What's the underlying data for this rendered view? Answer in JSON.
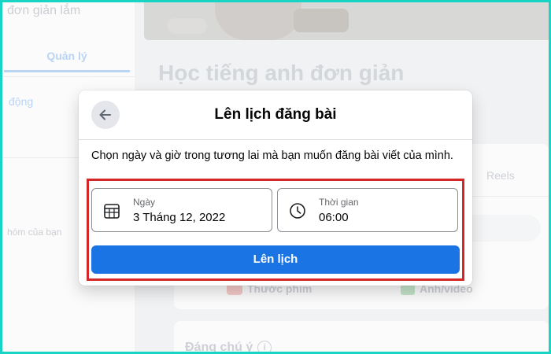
{
  "background": {
    "group_name_partial": "đơn giản lắm",
    "left_tab": "Quản lý",
    "left_link": "động",
    "left_group_hint": "hóm của bạn",
    "page_title": "Học tiếng anh đơn giản",
    "tabs": {
      "reels": "Reels"
    },
    "composer": {
      "video_label": "Thước phim",
      "photo_label": "Ảnh/video"
    },
    "notable_label": "Đáng chú ý",
    "notable_info_glyph": "i"
  },
  "modal": {
    "title": "Lên lịch đăng bài",
    "description": "Chọn ngày và giờ trong tương lai mà bạn muốn đăng bài viết của mình.",
    "back_icon": "arrow-left-icon",
    "date_field": {
      "label": "Ngày",
      "value": "3 Tháng 12, 2022",
      "icon": "calendar-icon"
    },
    "time_field": {
      "label": "Thời gian",
      "value": "06:00",
      "icon": "clock-icon"
    },
    "schedule_button": "Lên lịch"
  },
  "colors": {
    "outer_border": "#17d4c4",
    "primary_button": "#1b74e4",
    "highlight_box": "#d62728"
  }
}
